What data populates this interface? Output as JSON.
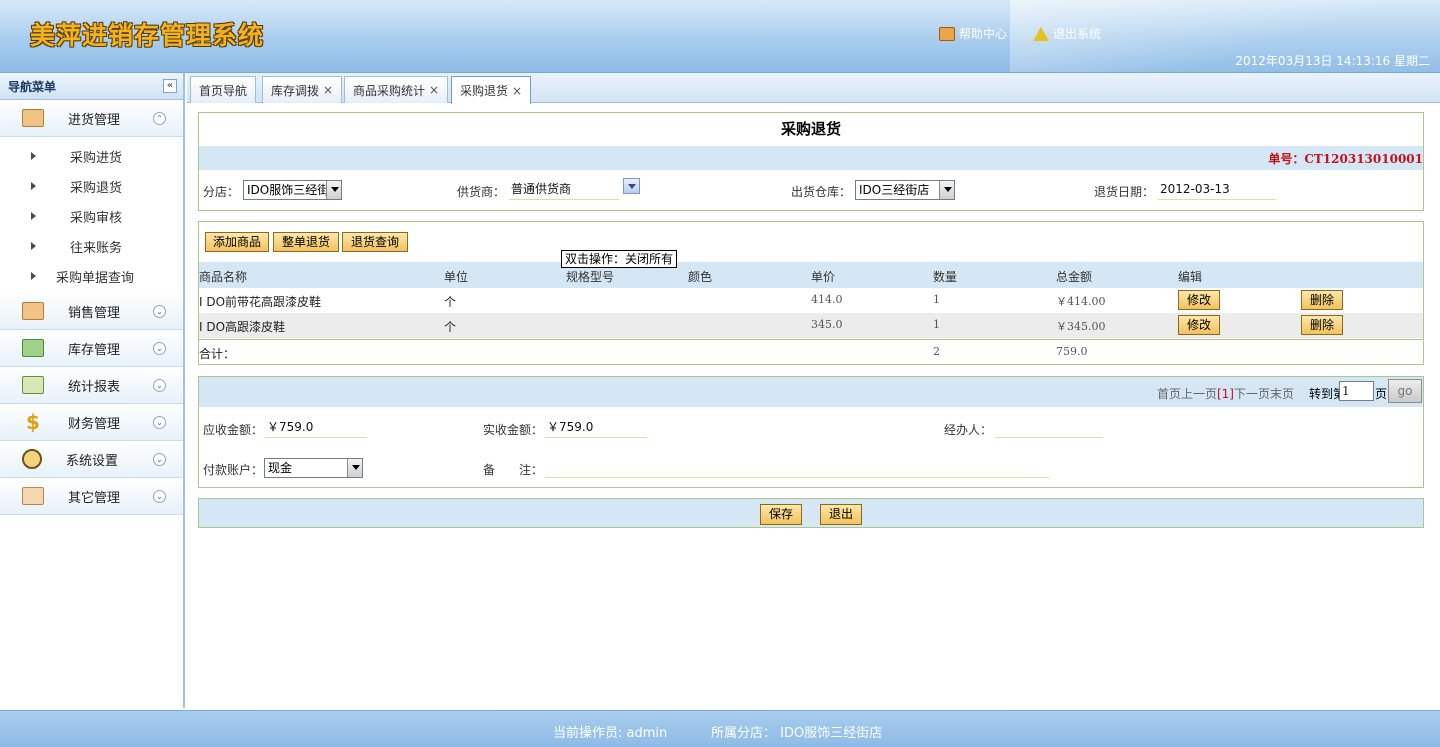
{
  "header": {
    "app_title": "美萍进销存管理系统",
    "help_label": "帮助中心",
    "exit_label": "退出系统",
    "datetime": "2012年03月13日 14:13:16 星期二"
  },
  "sidebar": {
    "title": "导航菜单",
    "collapse_glyph": "«",
    "groups": [
      {
        "label": "进货管理",
        "icon": "inbound-icon",
        "chevron": "⌃"
      },
      {
        "label": "销售管理",
        "icon": "sales-icon",
        "chevron": "⌄"
      },
      {
        "label": "库存管理",
        "icon": "stock-icon",
        "chevron": "⌄"
      },
      {
        "label": "统计报表",
        "icon": "report-icon",
        "chevron": "⌄"
      },
      {
        "label": "财务管理",
        "icon": "finance-icon",
        "chevron": "⌄"
      },
      {
        "label": "系统设置",
        "icon": "settings-icon",
        "chevron": "⌄"
      },
      {
        "label": "其它管理",
        "icon": "other-icon",
        "chevron": "⌄"
      }
    ],
    "sub_items": [
      "采购进货",
      "采购退货",
      "采购审核",
      "往来账务",
      "采购单据查询"
    ]
  },
  "tabs": [
    {
      "label": "首页导航",
      "closable": false
    },
    {
      "label": "库存调拨",
      "closable": true
    },
    {
      "label": "商品采购统计",
      "closable": true
    },
    {
      "label": "采购退货",
      "closable": true,
      "active": true
    }
  ],
  "tab_close": "×",
  "form": {
    "title": "采购退货",
    "doc_no": "单号：CT120313010001",
    "branch_label": "分店：",
    "branch_value": "IDO服饰三经街",
    "supplier_label": "供货商：",
    "supplier_value": "普通供货商",
    "warehouse_label": "出货仓库：",
    "warehouse_value": "IDO三经街店",
    "date_label": "退货日期：",
    "date_value": "2012-03-13"
  },
  "toolbar": {
    "add_goods": "添加商品",
    "whole_return": "整单退货",
    "return_query": "退货查询",
    "tooltip": "双击操作：关闭所有"
  },
  "table": {
    "headers": [
      "商品名称",
      "单位",
      "规格型号",
      "颜色",
      "单价",
      "数量",
      "总金额",
      "编辑"
    ],
    "rows": [
      {
        "name": "I DO前带花高跟漆皮鞋",
        "unit": "个",
        "spec": "",
        "color": "",
        "price": "414.0",
        "qty": "1",
        "total": "￥414.00",
        "edit": "修改",
        "delete": "删除"
      },
      {
        "name": "I DO高跟漆皮鞋",
        "unit": "个",
        "spec": "",
        "color": "",
        "price": "345.0",
        "qty": "1",
        "total": "￥345.00",
        "edit": "修改",
        "delete": "删除"
      }
    ],
    "total_label": "合计：",
    "total_qty": "2",
    "total_amount": "759.0"
  },
  "pager": {
    "first": "首页",
    "prev": "上一页",
    "current": "[1]",
    "next": "下一页",
    "last": "末页",
    "goto_label": "转到第",
    "page_input": "1",
    "page_suffix": "页",
    "go_label": "go"
  },
  "payment": {
    "receivable_label": "应收金额：",
    "receivable_value": "￥759.0",
    "received_label": "实收金额：",
    "received_value": "￥759.0",
    "handler_label": "经办人：",
    "handler_value": "",
    "account_label": "付款账户：",
    "account_value": "现金",
    "note_label": "备　　注：",
    "note_value": ""
  },
  "actions": {
    "save": "保存",
    "exit": "退出"
  },
  "footer": {
    "operator": "当前操作员:  admin",
    "branch": "所属分店：  IDO服饰三经街店"
  }
}
